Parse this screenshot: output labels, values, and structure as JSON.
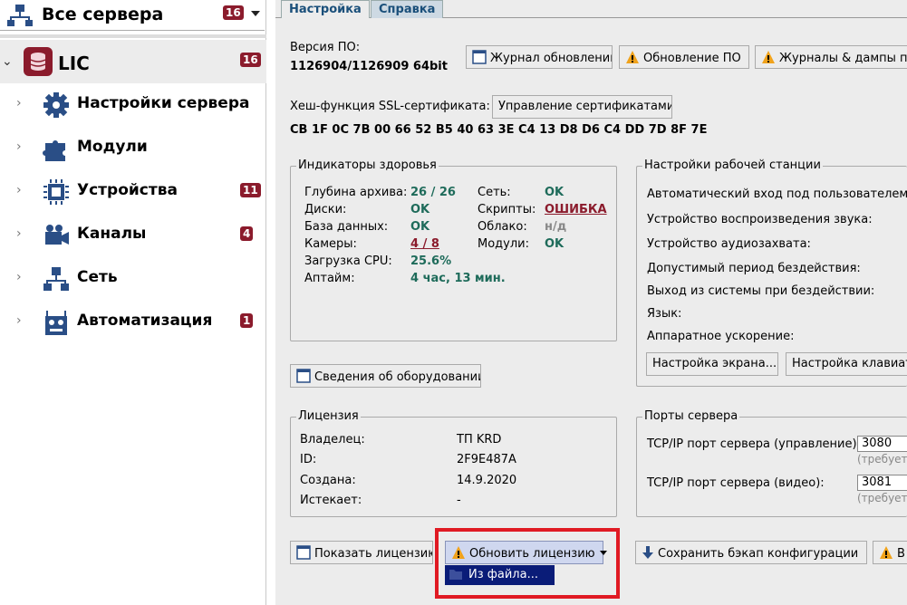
{
  "sidebar": {
    "server_selector": {
      "label": "Все сервера",
      "badge": "16"
    },
    "server": {
      "name": "LIC",
      "badge": "16"
    },
    "items": [
      {
        "label": "Настройки сервера",
        "icon": "gear-icon",
        "badge": ""
      },
      {
        "label": "Модули",
        "icon": "puzzle-icon",
        "badge": ""
      },
      {
        "label": "Устройства",
        "icon": "chip-icon",
        "badge": "11"
      },
      {
        "label": "Каналы",
        "icon": "camera-icon",
        "badge": "4"
      },
      {
        "label": "Сеть",
        "icon": "network-icon",
        "badge": ""
      },
      {
        "label": "Автоматизация",
        "icon": "robot-icon",
        "badge": "1"
      }
    ]
  },
  "tabs": [
    {
      "label": "Настройка"
    },
    {
      "label": "Справка"
    }
  ],
  "version": {
    "label": "Версия ПО:",
    "value": "1126904/1126909 64bit"
  },
  "top_buttons": {
    "update_log": "Журнал обновлений",
    "update_sw": "Обновление ПО",
    "logs_dumps": "Журналы & дампы па"
  },
  "ssl": {
    "label": "Хеш-функция SSL-сертификата:",
    "manage": "Управление сертификатами",
    "hash": "CB 1F 0C 7B 00 66 52 B5 40 63 3E C4 13 D8 D6 C4 DD 7D 8F 7E"
  },
  "health": {
    "title": "Индикаторы здоровья",
    "archive_depth": {
      "label": "Глубина архива:",
      "value": "26 / 26"
    },
    "disks": {
      "label": "Диски:",
      "value": "OK"
    },
    "database": {
      "label": "База данных:",
      "value": "OK"
    },
    "cameras": {
      "label": "Камеры:",
      "value": "4 / 8"
    },
    "cpu": {
      "label": "Загрузка CPU:",
      "value": "25.6%"
    },
    "uptime": {
      "label": "Аптайм:",
      "value": "4 час, 13 мин."
    },
    "network": {
      "label": "Сеть:",
      "value": "OK"
    },
    "scripts": {
      "label": "Скрипты:",
      "value": "ОШИБКА"
    },
    "cloud": {
      "label": "Облако:",
      "value": "н/д"
    },
    "modules": {
      "label": "Модули:",
      "value": "OK"
    }
  },
  "workstation": {
    "title": "Настройки рабочей станции",
    "rows": [
      "Автоматический вход под пользователем:",
      "Устройство воспроизведения звука:",
      "Устройство аудиозахвата:",
      "Допустимый период бездействия:",
      "Выход из системы при бездействии:",
      "Язык:",
      "Аппаратное ускорение:"
    ],
    "screen_btn": "Настройка экрана...",
    "keyboard_btn": "Настройка клавиат"
  },
  "hardware_btn": "Сведения об оборудовании",
  "license": {
    "title": "Лицензия",
    "owner": {
      "label": "Владелец:",
      "value": "ТП KRD"
    },
    "id": {
      "label": "ID:",
      "value": "2F9E487A"
    },
    "created": {
      "label": "Создана:",
      "value": "14.9.2020"
    },
    "expires": {
      "label": "Истекает:",
      "value": "-"
    }
  },
  "ports": {
    "title": "Порты сервера",
    "mgmt": {
      "label": "TCP/IP порт сервера (управление):",
      "value": "3080",
      "hint": "(требует"
    },
    "video": {
      "label": "TCP/IP порт сервера (видео):",
      "value": "3081",
      "hint": "(требует"
    }
  },
  "bottom": {
    "show_license": "Показать лицензию",
    "update_license": "Обновить лицензию",
    "menu_from_file": "Из файла...",
    "save_backup": "Сохранить бэкап конфигурации",
    "cut_btn": "В"
  },
  "colors": {
    "accent_red": "#8b1b2c",
    "ok_green": "#1e6b5a",
    "highlight_red": "#e01a23"
  }
}
